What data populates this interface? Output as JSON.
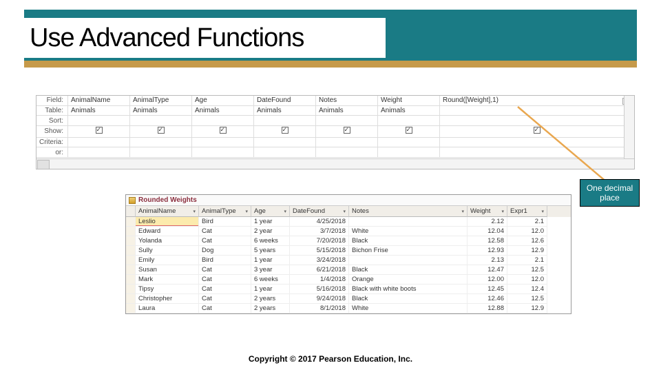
{
  "slide": {
    "title": "Use Advanced Functions",
    "callout": "One decimal place",
    "copyright": "Copyright © 2017 Pearson Education, Inc."
  },
  "queryGrid": {
    "rowLabels": [
      "Field:",
      "Table:",
      "Sort:",
      "Show:",
      "Criteria:",
      "or:"
    ],
    "columns": [
      {
        "field": "AnimalName",
        "table": "Animals",
        "show": true
      },
      {
        "field": "AnimalType",
        "table": "Animals",
        "show": true
      },
      {
        "field": "Age",
        "table": "Animals",
        "show": true
      },
      {
        "field": "DateFound",
        "table": "Animals",
        "show": true
      },
      {
        "field": "Notes",
        "table": "Animals",
        "show": true
      },
      {
        "field": "Weight",
        "table": "Animals",
        "show": true
      },
      {
        "field": "Round([Weight],1)",
        "table": "",
        "show": true
      }
    ]
  },
  "datasheet": {
    "title": "Rounded Weights",
    "columns": [
      "AnimalName",
      "AnimalType",
      "Age",
      "DateFound",
      "Notes",
      "Weight",
      "Expr1"
    ],
    "rows": [
      {
        "name": "Leslio",
        "type": "Bird",
        "age": "1 year",
        "date": "4/25/2018",
        "notes": "",
        "weight": "2.12",
        "expr": "2.1",
        "hl": true
      },
      {
        "name": "Edward",
        "type": "Cat",
        "age": "2 year",
        "date": "3/7/2018",
        "notes": "White",
        "weight": "12.04",
        "expr": "12.0"
      },
      {
        "name": "Yolanda",
        "type": "Cat",
        "age": "6 weeks",
        "date": "7/20/2018",
        "notes": "Black",
        "weight": "12.58",
        "expr": "12.6"
      },
      {
        "name": "Sully",
        "type": "Dog",
        "age": "5 years",
        "date": "5/15/2018",
        "notes": "Bichon Frise",
        "weight": "12.93",
        "expr": "12.9"
      },
      {
        "name": "Emily",
        "type": "Bird",
        "age": "1 year",
        "date": "3/24/2018",
        "notes": "",
        "weight": "2.13",
        "expr": "2.1"
      },
      {
        "name": "Susan",
        "type": "Cat",
        "age": "3 year",
        "date": "6/21/2018",
        "notes": "Black",
        "weight": "12.47",
        "expr": "12.5"
      },
      {
        "name": "Mark",
        "type": "Cat",
        "age": "6 weeks",
        "date": "1/4/2018",
        "notes": "Orange",
        "weight": "12.00",
        "expr": "12.0"
      },
      {
        "name": "Tipsy",
        "type": "Cat",
        "age": "1 year",
        "date": "5/16/2018",
        "notes": "Black with white boots",
        "weight": "12.45",
        "expr": "12.4"
      },
      {
        "name": "Christopher",
        "type": "Cat",
        "age": "2 years",
        "date": "9/24/2018",
        "notes": "Black",
        "weight": "12.46",
        "expr": "12.5"
      },
      {
        "name": "Laura",
        "type": "Cat",
        "age": "2 years",
        "date": "8/1/2018",
        "notes": "White",
        "weight": "12.88",
        "expr": "12.9"
      }
    ]
  }
}
